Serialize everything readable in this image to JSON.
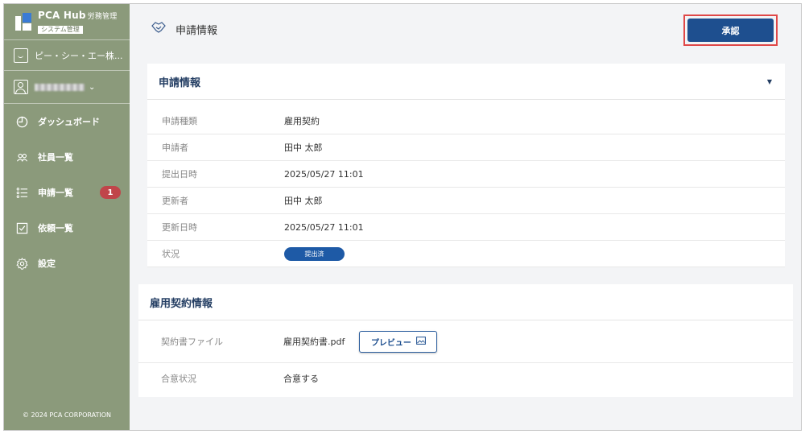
{
  "sidebar": {
    "logo_title": "PCA Hub",
    "logo_sub": "労務管理",
    "logo_badge": "システム管理",
    "company": "ピー・シー・エー株...",
    "nav": [
      {
        "label": "ダッシュボード",
        "icon": "clock-pie-icon"
      },
      {
        "label": "社員一覧",
        "icon": "people-icon"
      },
      {
        "label": "申請一覧",
        "icon": "list-icon",
        "badge": "1"
      },
      {
        "label": "依頼一覧",
        "icon": "checkbox-icon"
      },
      {
        "label": "設定",
        "icon": "gear-icon"
      }
    ],
    "copyright": "© 2024 PCA CORPORATION"
  },
  "header": {
    "title": "申請情報",
    "approve_label": "承認"
  },
  "application": {
    "title": "申請情報",
    "rows": [
      {
        "label": "申請種類",
        "value": "雇用契約"
      },
      {
        "label": "申請者",
        "value": "田中 太郎"
      },
      {
        "label": "提出日時",
        "value": "2025/05/27 11:01"
      },
      {
        "label": "更新者",
        "value": "田中 太郎"
      },
      {
        "label": "更新日時",
        "value": "2025/05/27 11:01"
      },
      {
        "label": "状況",
        "value": "提出済"
      }
    ]
  },
  "contract": {
    "title": "雇用契約情報",
    "file_label": "契約書ファイル",
    "file_name": "雇用契約書.pdf",
    "preview_label": "プレビュー",
    "agreement_label": "合意状況",
    "agreement_value": "合意する"
  },
  "colors": {
    "sidebar": "#8b9a7b",
    "primary": "#1e4f8f",
    "badge": "#c0454a",
    "highlight": "#e04848"
  }
}
